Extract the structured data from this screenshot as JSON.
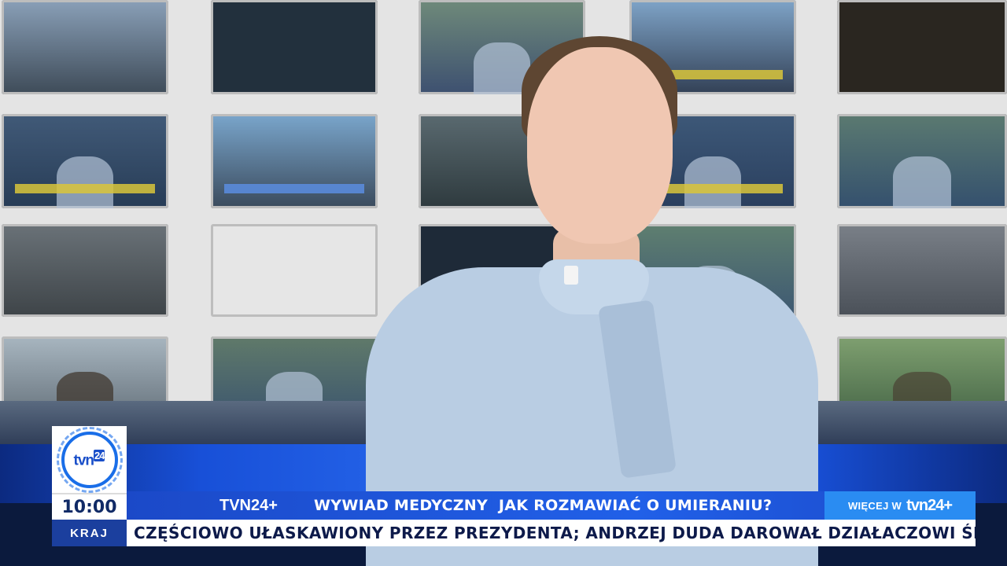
{
  "channel": {
    "logo_text": "tvn",
    "logo_number": "24"
  },
  "clock": {
    "time": "10:00"
  },
  "section": {
    "label": "KRAJ"
  },
  "top_bar": {
    "brand": "TVN24+",
    "program": "WYWIAD MEDYCZNY  JAK ROZMAWIAĆ O UMIERANIU?"
  },
  "more_button": {
    "label": "WIĘCEJ W",
    "brand": "tvn24+"
  },
  "ticker": {
    "text": "CZĘŚCIOWO UŁASKAWIONY PRZEZ PREZYDENTA; ANDRZEJ DUDA DAROWAŁ DZIAŁACZOWI ŚRODOWISKA"
  },
  "colors": {
    "primary_blue": "#1b49c8",
    "light_blue": "#2a8cf2",
    "section_blue": "#1b3f9e",
    "ticker_text": "#0d1a4a"
  },
  "icons": {
    "logo": "tvn24-logo-icon"
  }
}
